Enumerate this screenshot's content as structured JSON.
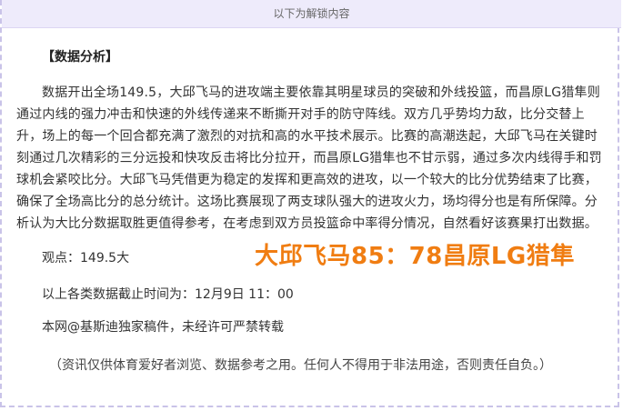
{
  "unlock_banner": "以下为解锁内容",
  "section_title": "【数据分析】",
  "analysis_paragraph": "数据开出全场149.5，大邱飞马的进攻端主要依靠其明星球员的突破和外线投篮，而昌原LG猎隼则通过内线的强力冲击和快速的外线传递来不断撕开对手的防守阵线。双方几乎势均力敌，比分交替上升，场上的每一个回合都充满了激烈的对抗和高的水平技术展示。比赛的高潮迭起，大邱飞马在关键时刻通过几次精彩的三分远投和快攻反击将比分拉开，而昌原LG猎隼也不甘示弱，通过多次内线得手和罚球机会紧咬比分。大邱飞马凭借更为稳定的发挥和更高效的进攻，以一个较大的比分优势结束了比赛，确保了全场高比分的总分统计。这场比赛展现了两支球队强大的进攻火力，场均得分也是有所保障。分析认为大比分数据取胜更值得参考，在考虑到双方员投篮命中率得分情况，自然看好该赛果打出数据。",
  "viewpoint": "观点：149.5大",
  "score_banner": "大邱飞马85：78昌原LG猎隼",
  "cutoff_time": "以上各类数据截止时间为：12月9日 11：00",
  "copyright": "本网@基斯迪独家稿件，未经许可严禁转载",
  "disclaimer": "（资讯仅供体育爱好者浏览、数据参考之用。任何人不得用于非法用途，否则责任自负。）",
  "colors": {
    "score_banner": "#f07d12",
    "unlock_bar_bg": "#eeebfb",
    "frame_border": "#c9c3e8"
  }
}
